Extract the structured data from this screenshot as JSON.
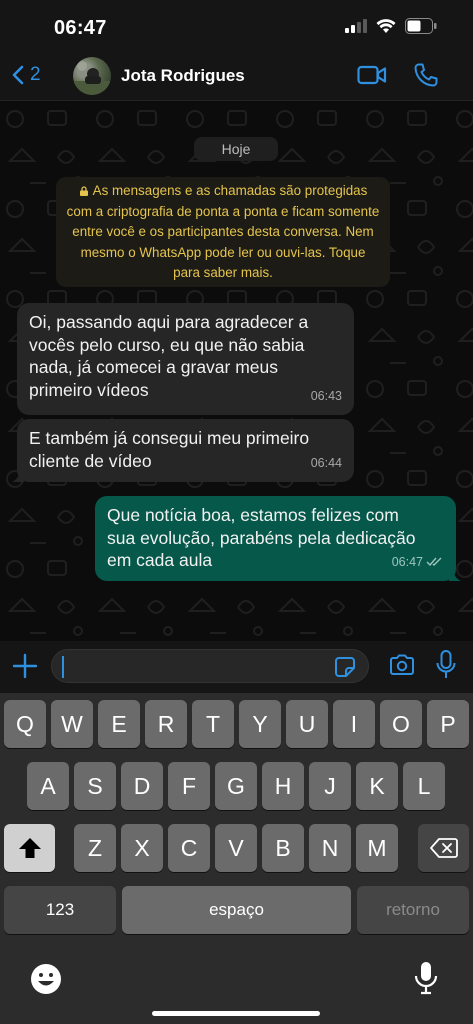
{
  "status_bar": {
    "time": "06:47"
  },
  "header": {
    "back_count": "2",
    "contact_name": "Jota Rodrigues",
    "icons": {
      "back": "chevron-left-icon",
      "video": "video-camera-icon",
      "phone": "phone-icon"
    }
  },
  "chat": {
    "date_label": "Hoje",
    "encryption_notice": "As mensagens e as chamadas são protegidas com a criptografia de ponta a ponta e ficam somente entre você e os participantes desta conversa. Nem mesmo o WhatsApp pode ler ou ouvi-las. Toque para saber mais.",
    "messages": [
      {
        "direction": "in",
        "lines": [
          "Oi, passando aqui para agradecer a",
          "vocês pelo curso, eu que não sabia",
          "nada, já comecei a gravar meus",
          "primeiro vídeos"
        ],
        "time": "06:43"
      },
      {
        "direction": "in",
        "lines": [
          "E também já consegui meu primeiro",
          "cliente de vídeo"
        ],
        "time": "06:44"
      },
      {
        "direction": "out",
        "lines": [
          "Que notícia boa, estamos felizes com",
          "sua evolução, parabéns pela dedicação",
          "em cada aula"
        ],
        "time": "06:47",
        "status": "read"
      }
    ]
  },
  "input_bar": {
    "placeholder": ""
  },
  "keyboard": {
    "row1": [
      "Q",
      "W",
      "E",
      "R",
      "T",
      "Y",
      "U",
      "I",
      "O",
      "P"
    ],
    "row2": [
      "A",
      "S",
      "D",
      "F",
      "G",
      "H",
      "J",
      "K",
      "L"
    ],
    "row3": [
      "Z",
      "X",
      "C",
      "V",
      "B",
      "N",
      "M"
    ],
    "numbers_label": "123",
    "space_label": "espaço",
    "return_label": "retorno"
  },
  "colors": {
    "accent": "#2f90e0",
    "outgoing": "#05584a",
    "incoming": "#262626",
    "notice_text": "#e5c44d"
  }
}
